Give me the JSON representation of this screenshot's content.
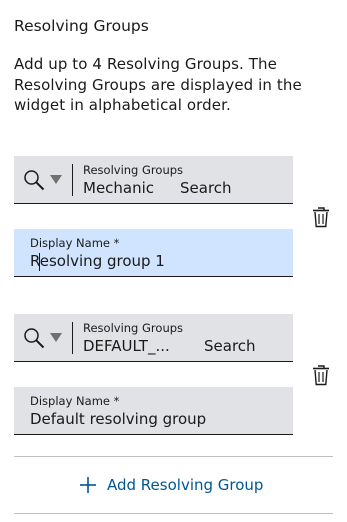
{
  "section": {
    "title": "Resolving Groups",
    "description": "Add up to 4 Resolving Groups. The Resolving Groups are displayed in the widget in alphabetical order."
  },
  "groups": [
    {
      "picker": {
        "label": "Resolving Groups",
        "value": "Mechanic",
        "search_label": "Search"
      },
      "display_name": {
        "label": "Display Name *",
        "value": "Resolving group 1",
        "focused": true
      },
      "delete_icon": "trash-icon"
    },
    {
      "picker": {
        "label": "Resolving Groups",
        "value": "DEFAULT_...",
        "search_label": "Search"
      },
      "display_name": {
        "label": "Display Name *",
        "value": "Default resolving group",
        "focused": false
      },
      "delete_icon": "trash-icon"
    }
  ],
  "add_button": {
    "label": "Add Resolving Group",
    "icon": "plus-icon"
  },
  "colors": {
    "field_bg": "#e0e2e5",
    "focused_bg": "#d1e4ff",
    "accent": "#005691",
    "icon_grey": "#707070",
    "divider": "#bfc0c2"
  }
}
